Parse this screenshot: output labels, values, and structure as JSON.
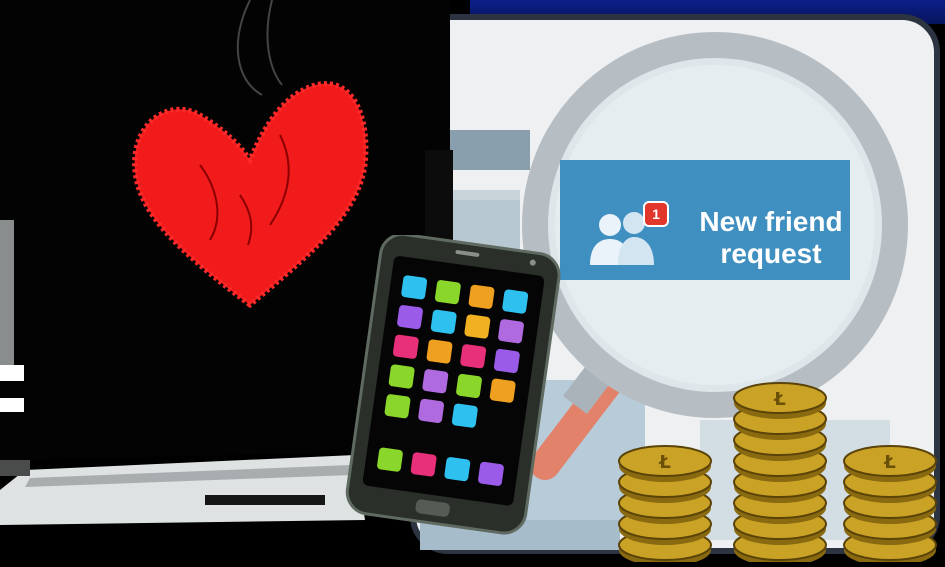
{
  "banner": {
    "badge_count": "1",
    "line1": "New friend",
    "line2": "request"
  },
  "icons": [
    "heart-icon",
    "friends-icon",
    "magnifier-icon",
    "coin-icon",
    "smartphone",
    "laptop"
  ],
  "colors": {
    "heart": "#f21b1b",
    "banner_blue": "#3f8fc0",
    "coin_gold": "#c9a226",
    "badge_red": "#e0362c",
    "phone_body": "#2a2f2a"
  },
  "phone_app_colors": [
    "#2ec1f0",
    "#8bd62a",
    "#f0a020",
    "#2ec1f0",
    "#9a5be8",
    "#2ec1f0",
    "#f0b020",
    "#b06ae0",
    "#e8307a",
    "#f0a020",
    "#e8307a",
    "#9a5be8",
    "#8bd62a",
    "#b06ae0",
    "#8bd62a",
    "#f0a020",
    "#8bd62a",
    "#b06ae0",
    "#2ec1f0"
  ],
  "phone_dock_colors": [
    "#8bd62a",
    "#e8307a",
    "#2ec1f0",
    "#9a5be8"
  ]
}
